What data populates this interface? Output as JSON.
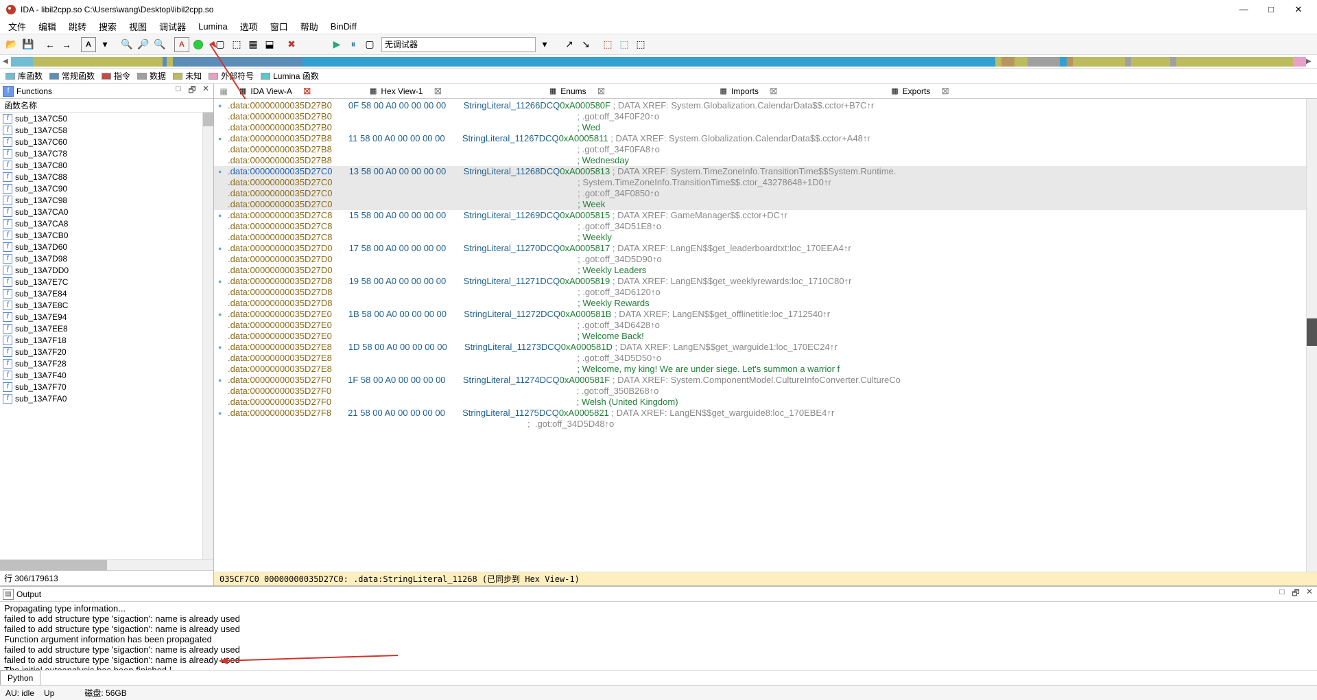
{
  "title": "IDA - libil2cpp.so C:\\Users\\wang\\Desktop\\libil2cpp.so",
  "menu": [
    "文件",
    "编辑",
    "跳转",
    "搜索",
    "视图",
    "调试器",
    "Lumina",
    "选项",
    "窗口",
    "帮助",
    "BinDiff"
  ],
  "debugger": "无调试器",
  "legend": [
    {
      "label": "库函数",
      "color": "#72bcd4"
    },
    {
      "label": "常规函数",
      "color": "#5b8db8"
    },
    {
      "label": "指令",
      "color": "#c24a4a"
    },
    {
      "label": "数据",
      "color": "#a0a0a0"
    },
    {
      "label": "未知",
      "color": "#bcbc5e"
    },
    {
      "label": "外部符号",
      "color": "#e8a0c8"
    },
    {
      "label": "Lumina 函数",
      "color": "#58c8c8"
    }
  ],
  "functions_panel": {
    "title": "Functions",
    "col": "函数名称",
    "items": [
      "sub_13A7C50",
      "sub_13A7C58",
      "sub_13A7C60",
      "sub_13A7C78",
      "sub_13A7C80",
      "sub_13A7C88",
      "sub_13A7C90",
      "sub_13A7C98",
      "sub_13A7CA0",
      "sub_13A7CA8",
      "sub_13A7CB0",
      "sub_13A7D60",
      "sub_13A7D98",
      "sub_13A7DD0",
      "sub_13A7E7C",
      "sub_13A7E84",
      "sub_13A7E8C",
      "sub_13A7E94",
      "sub_13A7EE8",
      "sub_13A7F18",
      "sub_13A7F20",
      "sub_13A7F28",
      "sub_13A7F40",
      "sub_13A7F70",
      "sub_13A7FA0"
    ],
    "status": "行 306/179613"
  },
  "tabs": [
    {
      "label": "IDA View-A",
      "active": true
    },
    {
      "label": "Hex View-1"
    },
    {
      "label": "Enums"
    },
    {
      "label": "Imports"
    },
    {
      "label": "Exports"
    }
  ],
  "disasm_status": "035CF7C0 00000000035D27C0: .data:StringLiteral_11268 (已同步到 Hex View-1)",
  "disasm": [
    {
      "dot": true,
      "addr": ".data:00000000035D27B0",
      "hex": "0F 58 00 A0 00 00 00 00",
      "lbl": "StringLiteral_11266",
      "op": "DCQ",
      "val": "0xA000580F",
      "cmt": "; DATA XREF: System.Globalization.CalendarData$$.cctor+B7C↑r"
    },
    {
      "addr": ".data:00000000035D27B0",
      "cmt": "; .got:off_34F0F20↑o"
    },
    {
      "addr": ".data:00000000035D27B0",
      "cmtg": "; Wed"
    },
    {
      "dot": true,
      "addr": ".data:00000000035D27B8",
      "hex": "11 58 00 A0 00 00 00 00",
      "lbl": "StringLiteral_11267",
      "op": "DCQ",
      "val": "0xA0005811",
      "cmt": "; DATA XREF: System.Globalization.CalendarData$$.cctor+A48↑r"
    },
    {
      "addr": ".data:00000000035D27B8",
      "cmt": "; .got:off_34F0FA8↑o"
    },
    {
      "addr": ".data:00000000035D27B8",
      "cmtg": "; Wednesday"
    },
    {
      "hl": true,
      "dot": true,
      "addr": ".data:00000000035D27C0",
      "addrhl": true,
      "hex": "13 58 00 A0 00 00 00 00",
      "lbl": "StringLiteral_11268",
      "op": "DCQ",
      "val": "0xA0005813",
      "cmt": "; DATA XREF: System.TimeZoneInfo.TransitionTime$$System.Runtime."
    },
    {
      "hl": true,
      "addr": ".data:00000000035D27C0",
      "cmt": "; System.TimeZoneInfo.TransitionTime$$.ctor_43278648+1D0↑r"
    },
    {
      "hl": true,
      "addr": ".data:00000000035D27C0",
      "cmt": "; .got:off_34F0850↑o"
    },
    {
      "hl": true,
      "addr": ".data:00000000035D27C0",
      "cmtg": "; Week"
    },
    {
      "dot": true,
      "addr": ".data:00000000035D27C8",
      "hex": "15 58 00 A0 00 00 00 00",
      "lbl": "StringLiteral_11269",
      "op": "DCQ",
      "val": "0xA0005815",
      "cmt": "; DATA XREF: GameManager$$.cctor+DC↑r"
    },
    {
      "addr": ".data:00000000035D27C8",
      "cmt": "; .got:off_34D51E8↑o"
    },
    {
      "addr": ".data:00000000035D27C8",
      "cmtg": "; Weekly"
    },
    {
      "dot": true,
      "addr": ".data:00000000035D27D0",
      "hex": "17 58 00 A0 00 00 00 00",
      "lbl": "StringLiteral_11270",
      "op": "DCQ",
      "val": "0xA0005817",
      "cmt": "; DATA XREF: LangEN$$get_leaderboardtxt:loc_170EEA4↑r"
    },
    {
      "addr": ".data:00000000035D27D0",
      "cmt": "; .got:off_34D5D90↑o"
    },
    {
      "addr": ".data:00000000035D27D0",
      "cmtg": "; Weekly Leaders"
    },
    {
      "dot": true,
      "addr": ".data:00000000035D27D8",
      "hex": "19 58 00 A0 00 00 00 00",
      "lbl": "StringLiteral_11271",
      "op": "DCQ",
      "val": "0xA0005819",
      "cmt": "; DATA XREF: LangEN$$get_weeklyrewards:loc_1710C80↑r"
    },
    {
      "addr": ".data:00000000035D27D8",
      "cmt": "; .got:off_34D6120↑o"
    },
    {
      "addr": ".data:00000000035D27D8",
      "cmtg": "; Weekly Rewards"
    },
    {
      "dot": true,
      "addr": ".data:00000000035D27E0",
      "hex": "1B 58 00 A0 00 00 00 00",
      "lbl": "StringLiteral_11272",
      "op": "DCQ",
      "val": "0xA000581B",
      "cmt": "; DATA XREF: LangEN$$get_offlinetitle:loc_1712540↑r"
    },
    {
      "addr": ".data:00000000035D27E0",
      "cmt": "; .got:off_34D6428↑o"
    },
    {
      "addr": ".data:00000000035D27E0",
      "cmtg": "; Welcome Back!"
    },
    {
      "dot": true,
      "addr": ".data:00000000035D27E8",
      "hex": "1D 58 00 A0 00 00 00 00",
      "lbl": "StringLiteral_11273",
      "op": "DCQ",
      "val": "0xA000581D",
      "cmt": "; DATA XREF: LangEN$$get_warguide1:loc_170EC24↑r"
    },
    {
      "addr": ".data:00000000035D27E8",
      "cmt": "; .got:off_34D5D50↑o"
    },
    {
      "addr": ".data:00000000035D27E8",
      "cmtg": "; Welcome, my king! We are under siege. Let's summon a warrior f"
    },
    {
      "dot": true,
      "addr": ".data:00000000035D27F0",
      "hex": "1F 58 00 A0 00 00 00 00",
      "lbl": "StringLiteral_11274",
      "op": "DCQ",
      "val": "0xA000581F",
      "cmt": "; DATA XREF: System.ComponentModel.CultureInfoConverter.CultureCo"
    },
    {
      "addr": ".data:00000000035D27F0",
      "cmt": "; .got:off_350B268↑o"
    },
    {
      "addr": ".data:00000000035D27F0",
      "cmtg": "; Welsh (United Kingdom)"
    },
    {
      "dot": true,
      "addr": ".data:00000000035D27F8",
      "hex": "21 58 00 A0 00 00 00 00",
      "lbl": "StringLiteral_11275",
      "op": "DCQ",
      "val": "0xA0005821",
      "cmt": "; DATA XREF: LangEN$$get_warguide8:loc_170EBE4↑r"
    },
    {
      "addr": "",
      "cmt": ";  .got:off_34D5D48↑o"
    }
  ],
  "output": {
    "title": "Output",
    "lines": [
      "Propagating type information...",
      "failed to add structure type 'sigaction': name is already used",
      "failed to add structure type 'sigaction': name is already used",
      "Function argument information has been propagated",
      "failed to add structure type 'sigaction': name is already used",
      "failed to add structure type 'sigaction': name is already used",
      "The initial autoanalysis has been finished."
    ]
  },
  "python_tab": "Python",
  "statusbar": {
    "au": "AU:  idle",
    "up": "Up",
    "disk": "磁盘: 56GB"
  }
}
